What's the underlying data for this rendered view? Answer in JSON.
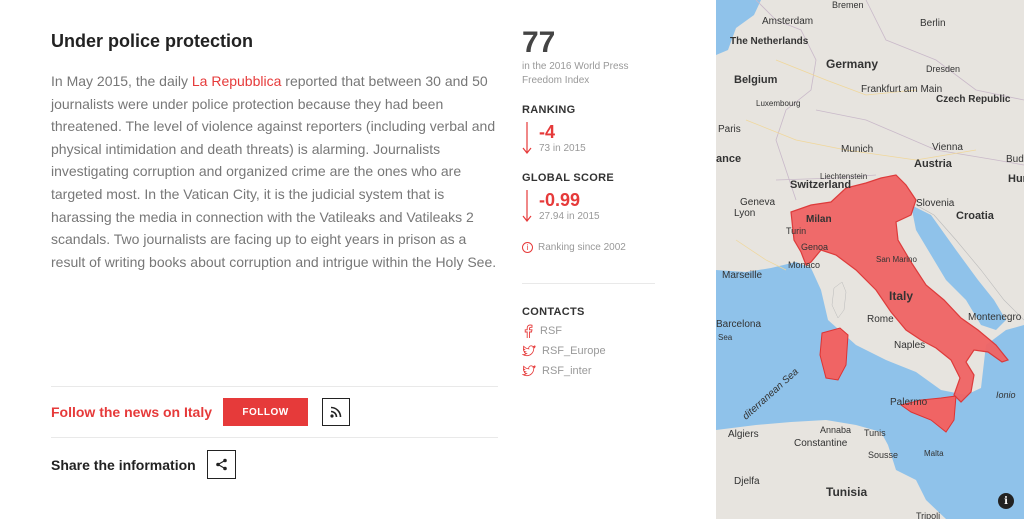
{
  "article": {
    "title": "Under police protection",
    "text_before_link": "In May 2015, the daily ",
    "link_text": "La Repubblica",
    "text_after_link": " reported that between 30 and 50 journalists were under police protection because they had been threatened. The level of violence against reporters (including verbal and physical intimidation and death threats) is alarming. Journalists investigating corruption and organized crime are the ones who are targeted most. In the Vatican City, it is the judicial system that is harassing the media in connection with the Vatileaks and Vatileaks 2 scandals. Two journalists are facing up to eight years in prison as a result of writing books about corruption and intrigue within the Holy See."
  },
  "follow": {
    "label": "Follow the news on Italy",
    "button": "FOLLOW",
    "rss_icon": "rss-icon"
  },
  "share": {
    "label": "Share the information",
    "icon": "share-icon"
  },
  "stats": {
    "rank": "77",
    "rank_caption": "in the 2016 World Press Freedom Index",
    "ranking_title": "RANKING",
    "ranking_change": "-4",
    "ranking_prev": "73 in 2015",
    "score_title": "GLOBAL SCORE",
    "score_change": "-0.99",
    "score_prev": "27.94 in 2015",
    "since_label": "Ranking since 2002",
    "accent_color": "#e63a3a"
  },
  "contacts": {
    "title": "CONTACTS",
    "items": [
      {
        "icon": "facebook-icon",
        "label": "RSF"
      },
      {
        "icon": "twitter-icon",
        "label": "RSF_Europe"
      },
      {
        "icon": "twitter-icon",
        "label": "RSF_inter"
      }
    ]
  },
  "map": {
    "highlight_color": "#f06464",
    "labels": {
      "bremen": "Bremen",
      "amsterdam": "Amsterdam",
      "berlin": "Berlin",
      "netherlands": "The Netherlands",
      "germany": "Germany",
      "belgium": "Belgium",
      "dresden": "Dresden",
      "frankfurt": "Frankfurt am Main",
      "luxembourg": "Luxembourg",
      "czech": "Czech Republic",
      "paris": "Paris",
      "munich": "Munich",
      "vienna": "Vienna",
      "bud": "Bud",
      "ance": "ance",
      "austria": "Austria",
      "hur": "Hur",
      "liechtenstein": "Liechtenstein",
      "switzerland": "Switzerland",
      "geneva": "Geneva",
      "lyon": "Lyon",
      "slovenia": "Slovenia",
      "croatia": "Croatia",
      "milan": "Milan",
      "turin": "Turin",
      "genoa": "Genoa",
      "sanmarino": "San Marino",
      "marseille": "Marseille",
      "monaco": "Monaco",
      "italy": "Italy",
      "barcelona": "Barcelona",
      "rome": "Rome",
      "montenegro": "Montenegro",
      "naples": "Naples",
      "mediterranean": "diterranean Sea",
      "sea": "Sea",
      "palermo": "Palermo",
      "ionic": "Ionio",
      "algiers": "Algiers",
      "annaba": "Annaba",
      "tunis": "Tunis",
      "constantine": "Constantine",
      "sousse": "Sousse",
      "malta": "Malta",
      "djelfa": "Djelfa",
      "tunisia": "Tunisia",
      "tripoli": "Tripoli"
    }
  }
}
